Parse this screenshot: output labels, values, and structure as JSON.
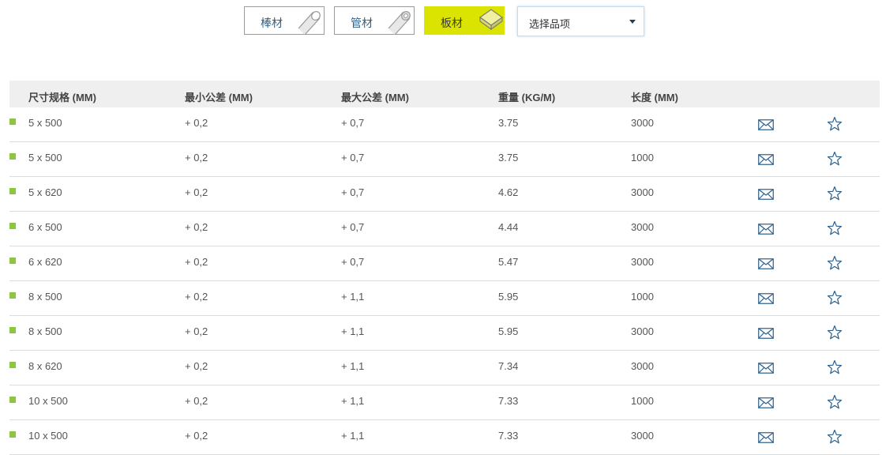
{
  "filters": {
    "categories": [
      {
        "label": "棒材",
        "icon": "rod-icon",
        "active": false
      },
      {
        "label": "管材",
        "icon": "tube-icon",
        "active": false
      },
      {
        "label": "板材",
        "icon": "plate-icon",
        "active": true
      }
    ],
    "select_label": "选择品项",
    "active_color": "#dbe400"
  },
  "table": {
    "headers": [
      "尺寸规格 (MM)",
      "最小公差 (MM)",
      "最大公差 (MM)",
      "重量 (KG/M)",
      "长度 (MM)"
    ],
    "rows": [
      {
        "size": "5 x 500",
        "min_tol": "+ 0,2",
        "max_tol": "+ 0,7",
        "weight": "3.75",
        "length": "3000"
      },
      {
        "size": "5 x 500",
        "min_tol": "+ 0,2",
        "max_tol": "+ 0,7",
        "weight": "3.75",
        "length": "1000"
      },
      {
        "size": "5 x 620",
        "min_tol": "+ 0,2",
        "max_tol": "+ 0,7",
        "weight": "4.62",
        "length": "3000"
      },
      {
        "size": "6 x 500",
        "min_tol": "+ 0,2",
        "max_tol": "+ 0,7",
        "weight": "4.44",
        "length": "3000"
      },
      {
        "size": "6 x 620",
        "min_tol": "+ 0,2",
        "max_tol": "+ 0,7",
        "weight": "5.47",
        "length": "3000"
      },
      {
        "size": "8 x 500",
        "min_tol": "+ 0,2",
        "max_tol": "+ 1,1",
        "weight": "5.95",
        "length": "1000"
      },
      {
        "size": "8 x 500",
        "min_tol": "+ 0,2",
        "max_tol": "+ 1,1",
        "weight": "5.95",
        "length": "3000"
      },
      {
        "size": "8 x 620",
        "min_tol": "+ 0,2",
        "max_tol": "+ 1,1",
        "weight": "7.34",
        "length": "3000"
      },
      {
        "size": "10 x 500",
        "min_tol": "+ 0,2",
        "max_tol": "+ 1,1",
        "weight": "7.33",
        "length": "1000"
      },
      {
        "size": "10 x 500",
        "min_tol": "+ 0,2",
        "max_tol": "+ 1,1",
        "weight": "7.33",
        "length": "3000"
      }
    ],
    "row_icons": [
      "mail-icon",
      "star-icon"
    ],
    "bullet_color": "#8cc63f",
    "icon_color": "#2b5f8a"
  }
}
